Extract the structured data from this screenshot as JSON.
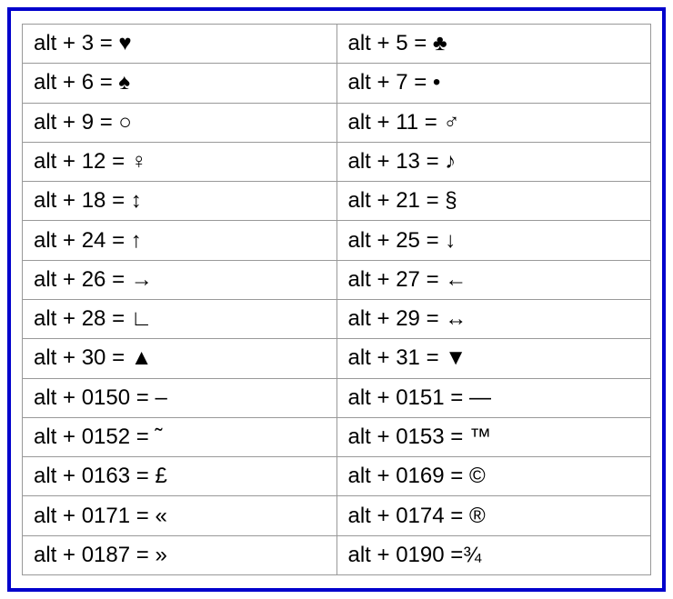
{
  "rows": [
    {
      "left_code": "alt + 3 = ",
      "left_symbol": "♥",
      "right_code": "alt + 5 = ",
      "right_symbol": "♣"
    },
    {
      "left_code": "alt + 6 = ",
      "left_symbol": "♠",
      "right_code": "alt + 7 = ",
      "right_symbol": "•"
    },
    {
      "left_code": "alt + 9 = ",
      "left_symbol": "○",
      "right_code": "alt + 11 = ",
      "right_symbol": "♂"
    },
    {
      "left_code": "alt + 12 = ",
      "left_symbol": "♀",
      "right_code": "alt + 13 = ",
      "right_symbol": "♪"
    },
    {
      "left_code": "alt + 18 = ",
      "left_symbol": "↕",
      "right_code": "alt + 21 = ",
      "right_symbol": "§"
    },
    {
      "left_code": "alt + 24 = ",
      "left_symbol": "↑",
      "right_code": "alt + 25 = ",
      "right_symbol": "↓"
    },
    {
      "left_code": "alt + 26 = ",
      "left_symbol": "→",
      "right_code": "alt + 27 = ",
      "right_symbol": "←"
    },
    {
      "left_code": "alt + 28 = ",
      "left_symbol": "∟",
      "right_code": "alt + 29 = ",
      "right_symbol": "↔"
    },
    {
      "left_code": "alt + 30 = ",
      "left_symbol": "▲",
      "right_code": "alt + 31 = ",
      "right_symbol": "▼"
    },
    {
      "left_code": "alt + 0150 = ",
      "left_symbol": "–",
      "right_code": "alt + 0151 = ",
      "right_symbol": "—"
    },
    {
      "left_code": "alt + 0152 = ",
      "left_symbol": "˜",
      "right_code": "alt + 0153 = ",
      "right_symbol": "™"
    },
    {
      "left_code": "alt + 0163 = ",
      "left_symbol": "£",
      "right_code": "alt + 0169 = ",
      "right_symbol": "©"
    },
    {
      "left_code": "alt + 0171 = ",
      "left_symbol": "«",
      "right_code": "alt + 0174 = ",
      "right_symbol": "®"
    },
    {
      "left_code": "alt + 0187 = ",
      "left_symbol": "»",
      "right_code": "alt + 0190 =",
      "right_symbol": "¾"
    }
  ]
}
